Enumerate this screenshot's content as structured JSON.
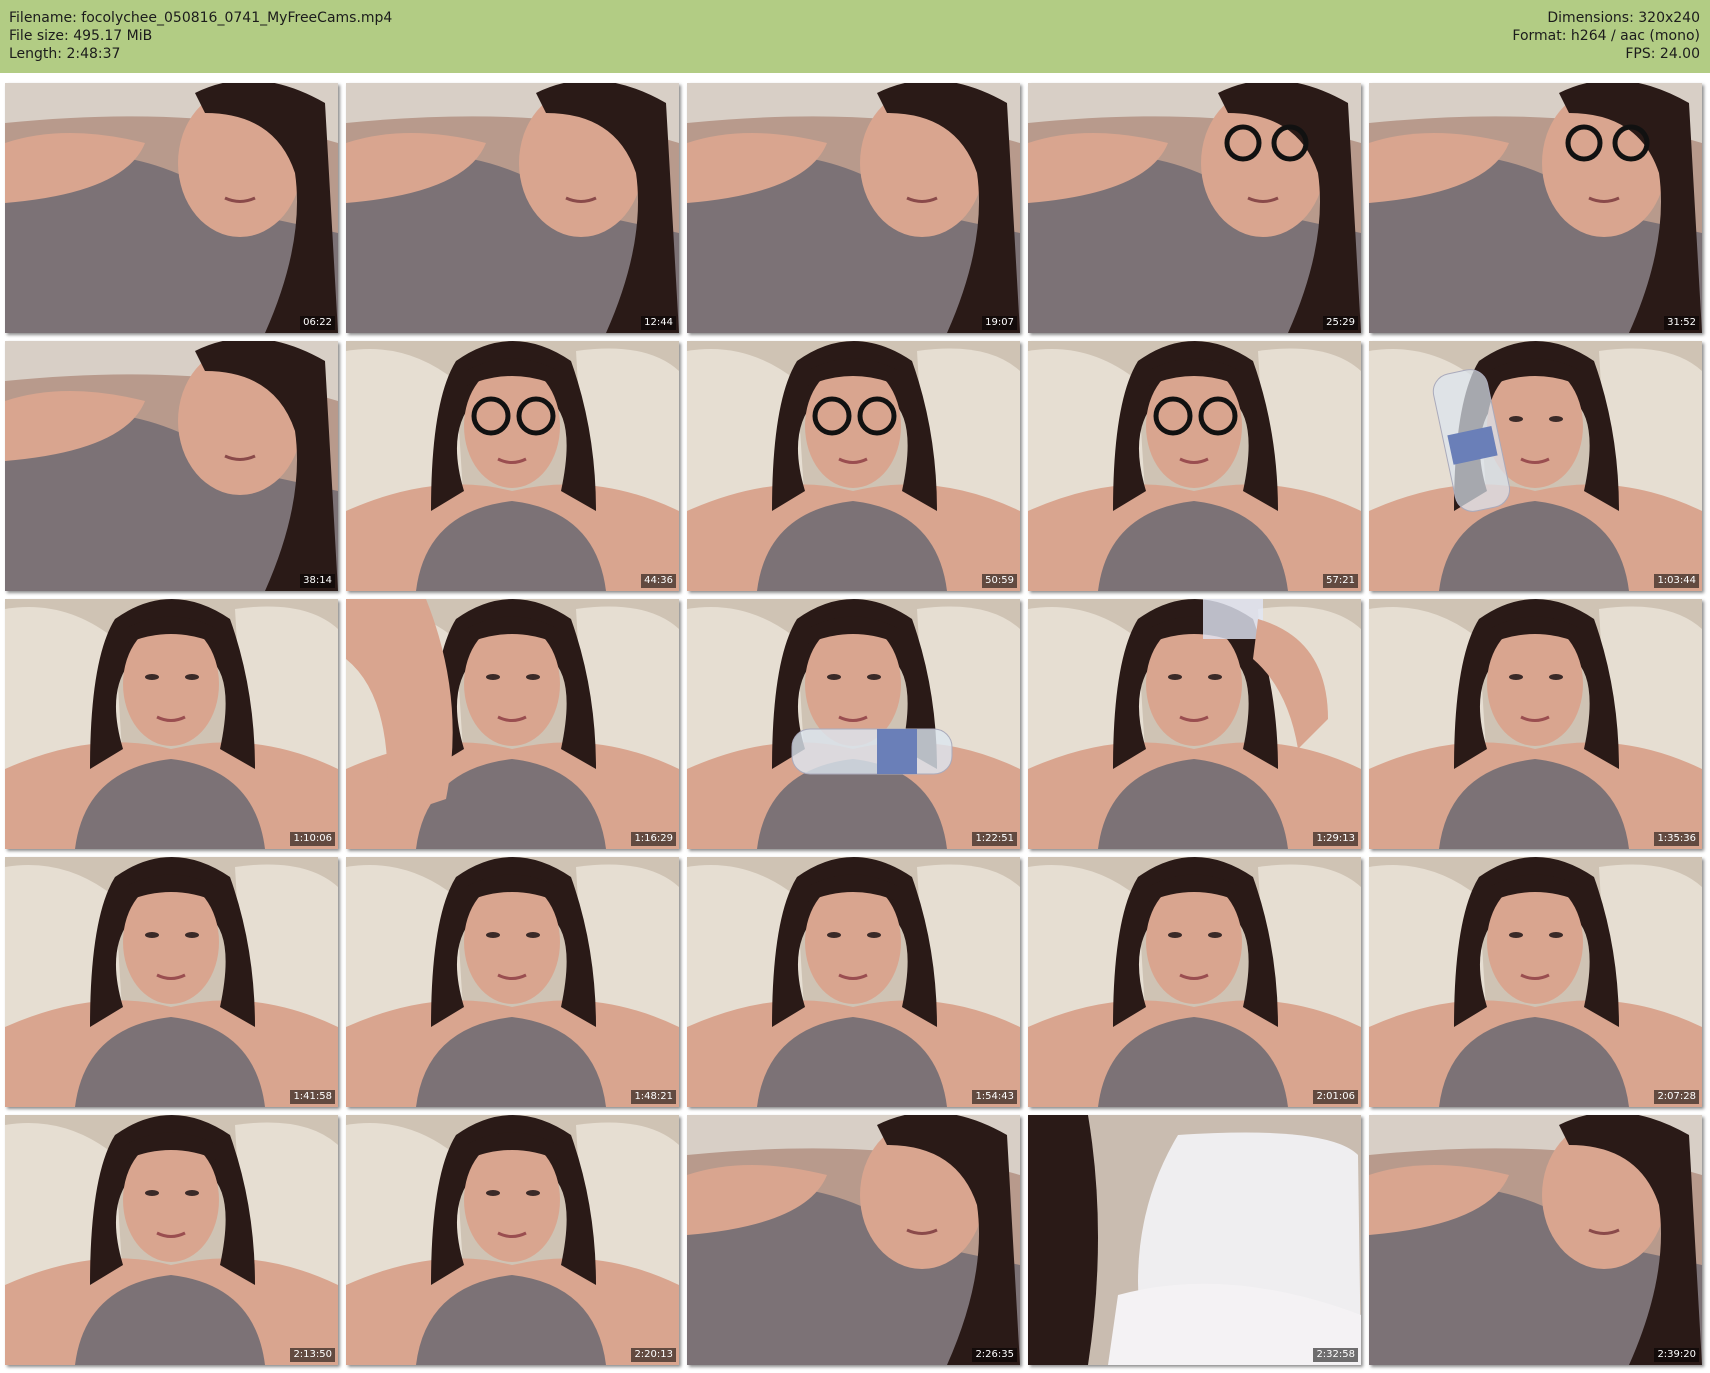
{
  "header": {
    "filename": "Filename: focolychee_050816_0741_MyFreeCams.mp4",
    "filesize": "File size: 495.17 MiB",
    "length": "Length: 2:48:37",
    "dimensions": "Dimensions: 320x240",
    "format": "Format: h264 / aac (mono)",
    "fps": "FPS: 24.00"
  },
  "colors": {
    "header_bg": "#b2cc84",
    "page_bg": "#ffffff",
    "timestamp_text": "#ffffff"
  },
  "thumbnails": [
    {
      "timestamp": "06:22",
      "scene": "close-lying"
    },
    {
      "timestamp": "12:44",
      "scene": "close-lying"
    },
    {
      "timestamp": "19:07",
      "scene": "close-lying"
    },
    {
      "timestamp": "25:29",
      "scene": "glasses-lying"
    },
    {
      "timestamp": "31:52",
      "scene": "glasses-lying"
    },
    {
      "timestamp": "38:14",
      "scene": "arm-raised"
    },
    {
      "timestamp": "44:36",
      "scene": "glasses-pillow"
    },
    {
      "timestamp": "50:59",
      "scene": "glasses-pillow"
    },
    {
      "timestamp": "57:21",
      "scene": "glasses-pillow"
    },
    {
      "timestamp": "1:03:44",
      "scene": "bottle"
    },
    {
      "timestamp": "1:10:06",
      "scene": "pillow"
    },
    {
      "timestamp": "1:16:29",
      "scene": "arm-raised-pillow"
    },
    {
      "timestamp": "1:22:51",
      "scene": "bottle-chest"
    },
    {
      "timestamp": "1:29:13",
      "scene": "drinking"
    },
    {
      "timestamp": "1:35:36",
      "scene": "pillow"
    },
    {
      "timestamp": "1:41:58",
      "scene": "pillow"
    },
    {
      "timestamp": "1:48:21",
      "scene": "pillow"
    },
    {
      "timestamp": "1:54:43",
      "scene": "pillow"
    },
    {
      "timestamp": "2:01:06",
      "scene": "pillow"
    },
    {
      "timestamp": "2:07:28",
      "scene": "pillow"
    },
    {
      "timestamp": "2:13:50",
      "scene": "pillow"
    },
    {
      "timestamp": "2:20:13",
      "scene": "pillow"
    },
    {
      "timestamp": "2:26:35",
      "scene": "close-lying"
    },
    {
      "timestamp": "2:32:58",
      "scene": "pillow-only"
    },
    {
      "timestamp": "2:39:20",
      "scene": "close-lying"
    }
  ]
}
